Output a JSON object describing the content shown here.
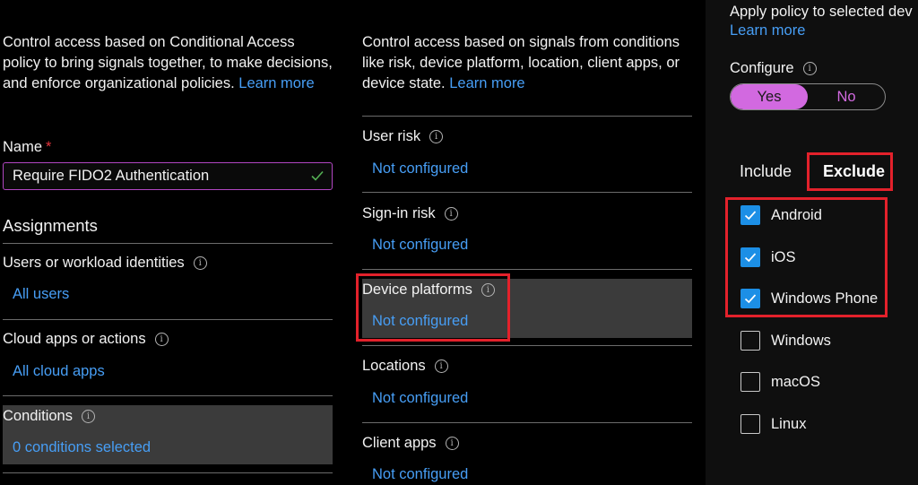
{
  "left": {
    "description": "Control access based on Conditional Access policy to bring signals together, to make decisions, and enforce organizational policies.",
    "learn_more": "Learn more",
    "name_label": "Name",
    "required_mark": "*",
    "name_value": "Require FIDO2 Authentication",
    "assignments_title": "Assignments",
    "users": {
      "label": "Users or workload identities",
      "value": "All users"
    },
    "cloud_apps": {
      "label": "Cloud apps or actions",
      "value": "All cloud apps"
    },
    "conditions": {
      "label": "Conditions",
      "value": "0 conditions selected"
    }
  },
  "middle": {
    "description": "Control access based on signals from conditions like risk, device platform, location, client apps, or device state.",
    "learn_more": "Learn more",
    "user_risk": {
      "label": "User risk",
      "value": "Not configured"
    },
    "signin_risk": {
      "label": "Sign-in risk",
      "value": "Not configured"
    },
    "device_platforms": {
      "label": "Device platforms",
      "value": "Not configured"
    },
    "locations": {
      "label": "Locations",
      "value": "Not configured"
    },
    "client_apps": {
      "label": "Client apps",
      "value": "Not configured"
    }
  },
  "right": {
    "apply_text": "Apply policy to selected dev",
    "learn_more": "Learn more",
    "configure_label": "Configure",
    "toggle": {
      "yes": "Yes",
      "no": "No",
      "selected": "Yes"
    },
    "tabs": {
      "include": "Include",
      "exclude": "Exclude",
      "active": "Exclude"
    },
    "platforms": [
      {
        "label": "Android",
        "checked": true
      },
      {
        "label": "iOS",
        "checked": true
      },
      {
        "label": "Windows Phone",
        "checked": true
      },
      {
        "label": "Windows",
        "checked": false
      },
      {
        "label": "macOS",
        "checked": false
      },
      {
        "label": "Linux",
        "checked": false
      }
    ]
  },
  "icons": {
    "info": "info-icon",
    "check": "check-icon",
    "checkbox_check": "checkbox-check-icon"
  },
  "colors": {
    "background": "#000000",
    "link": "#479ef5",
    "accent": "#d269e0",
    "checkbox": "#1c8fe6",
    "highlight": "#e3212b",
    "selected_row": "#3b3b3b"
  }
}
